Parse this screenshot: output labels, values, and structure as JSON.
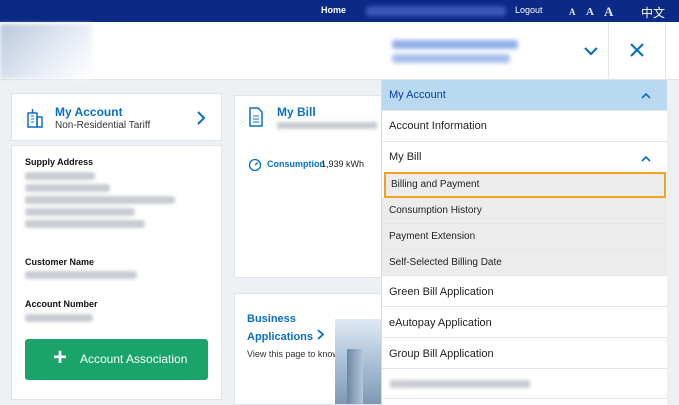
{
  "topbar": {
    "home": "Home",
    "logout": "Logout",
    "font_sizes": [
      "A",
      "A",
      "A"
    ],
    "language": "中文"
  },
  "account_card": {
    "title": "My Account",
    "subtitle": "Non-Residential Tariff",
    "supply_address_label": "Supply Address",
    "customer_name_label": "Customer Name",
    "account_number_label": "Account Number",
    "association_button": "Account Association"
  },
  "bill_card": {
    "title": "My Bill",
    "consumption_label": "Consumption",
    "consumption_value": "1,939 kWh"
  },
  "business_card": {
    "title_line1": "Business",
    "title_line2": "Applications",
    "description": "View this page to know..."
  },
  "menu": {
    "header": "My Account",
    "items": [
      "Account Information",
      "My Bill",
      "Billing and Payment",
      "Consumption History",
      "Payment Extension",
      "Self-Selected Billing Date",
      "Green Bill Application",
      "eAutopay Application",
      "Group Bill Application"
    ]
  },
  "colors": {
    "topbar": "#0a2a86",
    "accent_blue": "#0a6fc4",
    "green_button": "#1aa36b",
    "highlight_border": "#f3a21f",
    "menu_header": "#b9d9f0"
  }
}
